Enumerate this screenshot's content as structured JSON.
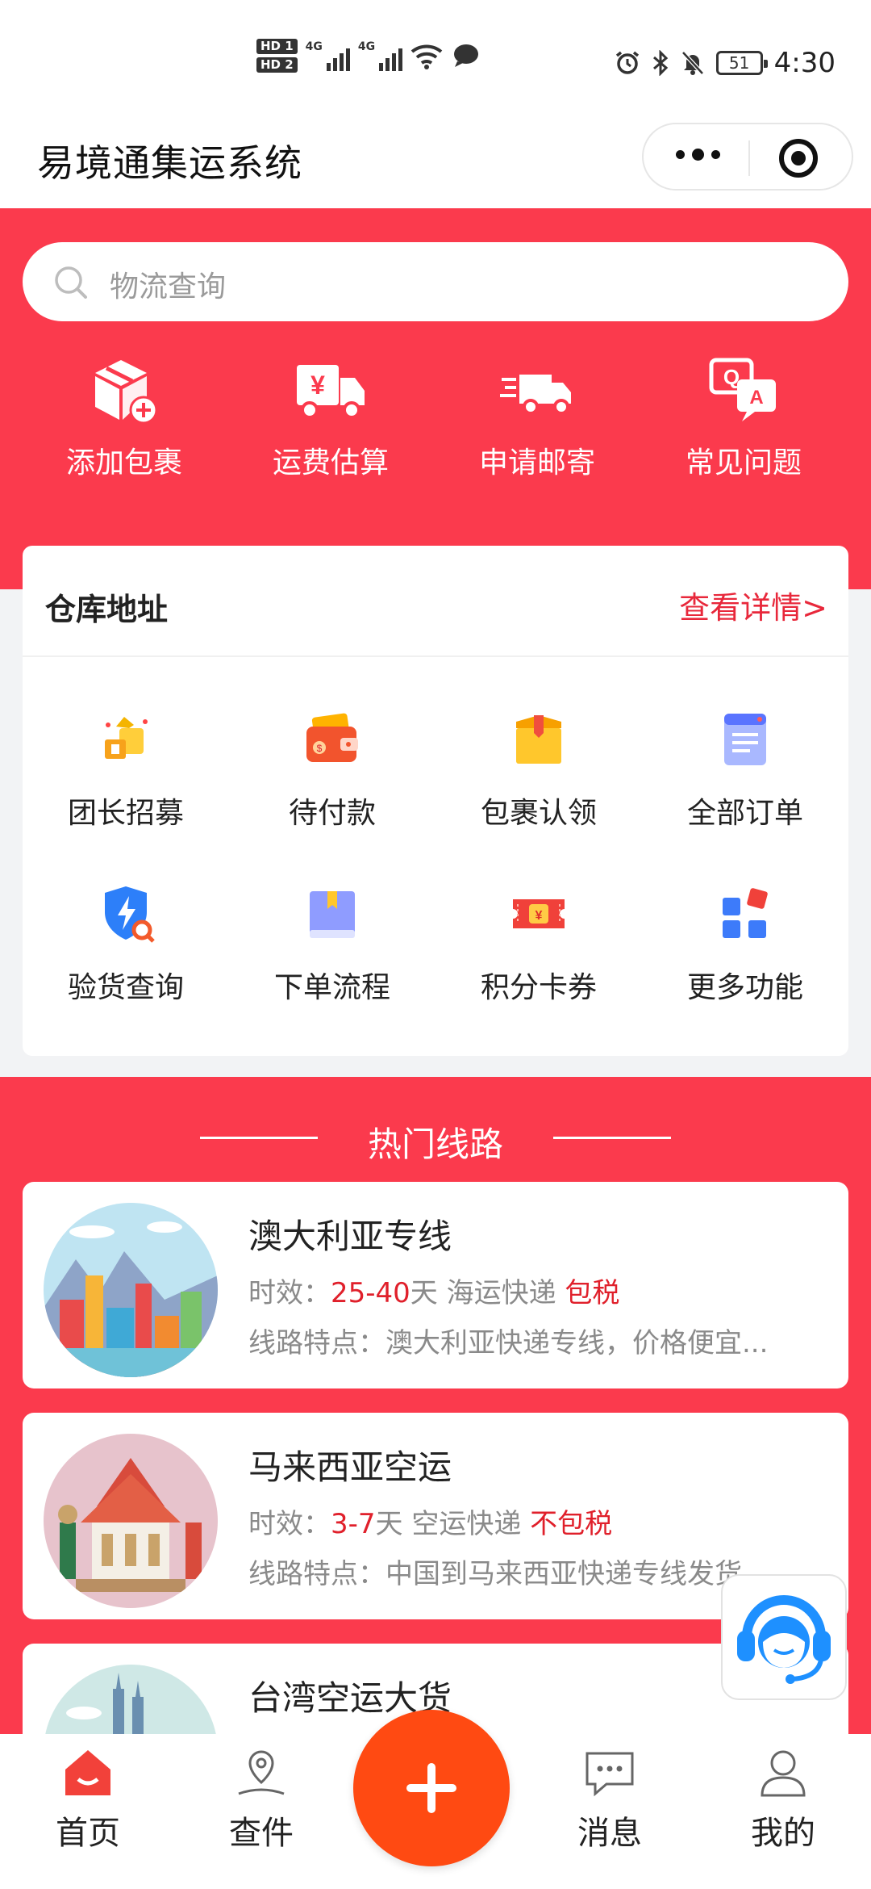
{
  "status_bar": {
    "hd1": "HD 1",
    "hd2": "HD 2",
    "net1": "4G",
    "net2": "4G",
    "wifi_tag": "6",
    "battery": "51",
    "time": "4:30"
  },
  "title_bar": {
    "title": "易境通集运系统"
  },
  "search": {
    "placeholder": "物流查询"
  },
  "quick_actions": [
    {
      "label": "添加包裹",
      "icon": "package-add-icon"
    },
    {
      "label": "运费估算",
      "icon": "freight-truck-icon"
    },
    {
      "label": "申请邮寄",
      "icon": "delivery-truck-icon"
    },
    {
      "label": "常见问题",
      "icon": "qa-icon"
    }
  ],
  "warehouse_card": {
    "title": "仓库地址",
    "link": "查看详情>"
  },
  "feature_grid": [
    {
      "label": "团长招募",
      "icon": "recruit-icon"
    },
    {
      "label": "待付款",
      "icon": "wallet-icon"
    },
    {
      "label": "包裹认领",
      "icon": "box-icon"
    },
    {
      "label": "全部订单",
      "icon": "orders-icon"
    },
    {
      "label": "验货查询",
      "icon": "inspect-shield-icon"
    },
    {
      "label": "下单流程",
      "icon": "book-icon"
    },
    {
      "label": "积分卡券",
      "icon": "coupon-icon"
    },
    {
      "label": "更多功能",
      "icon": "more-grid-icon"
    }
  ],
  "hot_routes": {
    "title": "热门线路",
    "routes": [
      {
        "name": "澳大利亚专线",
        "time_label": "时效：",
        "days": "25-40",
        "days_unit": "天",
        "mode": "海运快递",
        "tax": "包税",
        "desc_label": "线路特点：",
        "desc": "澳大利亚快递专线，价格便宜..."
      },
      {
        "name": "马来西亚空运",
        "time_label": "时效：",
        "days": "3-7",
        "days_unit": "天",
        "mode": "空运快递",
        "tax": "不包税",
        "desc_label": "线路特点：",
        "desc": "中国到马来西亚快递专线发货"
      },
      {
        "name": "台湾空运大货"
      }
    ]
  },
  "tab_bar": [
    {
      "label": "首页",
      "icon": "home-icon",
      "active": true
    },
    {
      "label": "查件",
      "icon": "location-pin-icon",
      "active": false
    },
    {
      "label": "消息",
      "icon": "message-icon",
      "active": false
    },
    {
      "label": "我的",
      "icon": "user-icon",
      "active": false
    }
  ],
  "colors": {
    "brand_red": "#fb3a4d",
    "fab_orange": "#ff4a12",
    "text_red": "#e0202b"
  }
}
